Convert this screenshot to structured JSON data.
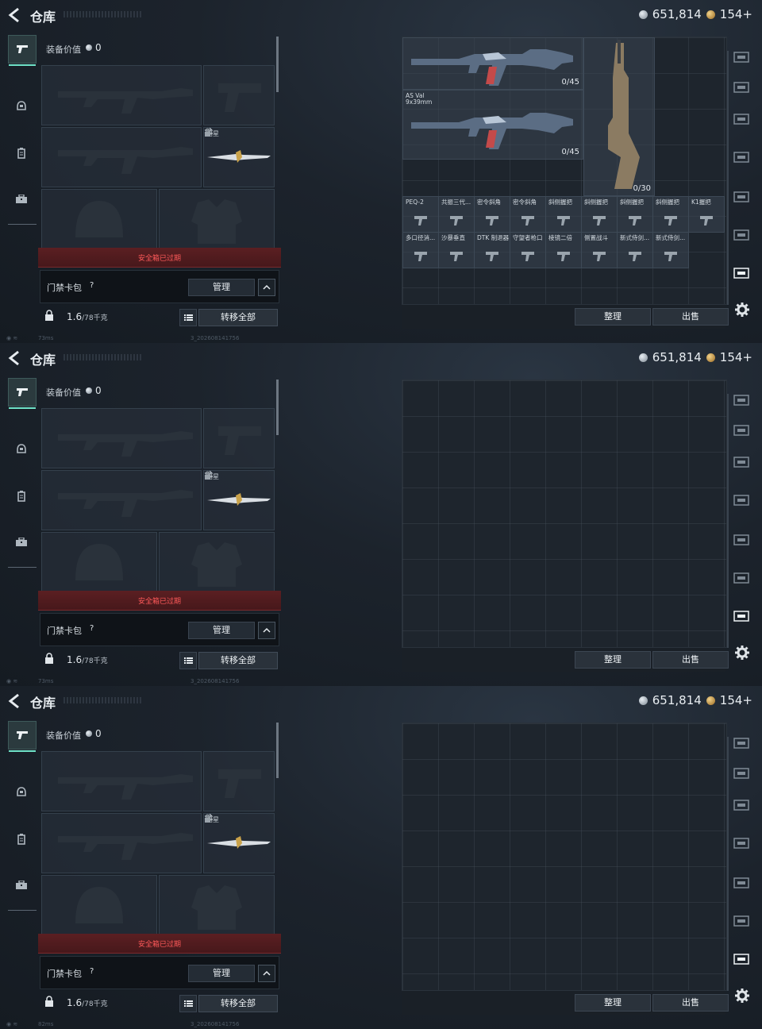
{
  "header": {
    "title": "仓库",
    "silver": "651,814",
    "gold": "154+"
  },
  "loadout": {
    "value_label": "装备价值",
    "value": "0",
    "melee_name": "暗星",
    "safebox_text": "安全箱已过期",
    "keycard_label": "门禁卡包",
    "help": "?",
    "manage": "管理",
    "weight": "1.6",
    "weight_max": "/78千克",
    "transfer_all": "转移全部"
  },
  "stash": {
    "gun1_count": "0/45",
    "gun2_name": "AS Val",
    "gun2_caliber": "9x39mm",
    "gun2_count": "0/45",
    "gun3_count": "0/30",
    "items": [
      "PEQ-2",
      "共振三代...",
      "密令斜角",
      "密令斜角",
      "斜侧握把",
      "斜侧握把",
      "斜侧握把",
      "斜侧握把",
      "K1握把",
      "多口径消...",
      "沙暴垂直",
      "DTK 制退器",
      "守望者枪口",
      "棱镜二倍",
      "侧置战斗",
      "新式侍剑...",
      "新式侍剑..."
    ],
    "tidy": "整理",
    "sell": "出售"
  },
  "status": [
    {
      "ping": "73ms",
      "uid": "3_202608141756"
    },
    {
      "ping": "73ms",
      "uid": "3_202608141756"
    },
    {
      "ping": "82ms",
      "uid": "3_202608141756"
    }
  ],
  "colors": {
    "accent": "#6fe3c8",
    "alert": "#ff5a5a",
    "alert_bg": "#5b1f22"
  }
}
